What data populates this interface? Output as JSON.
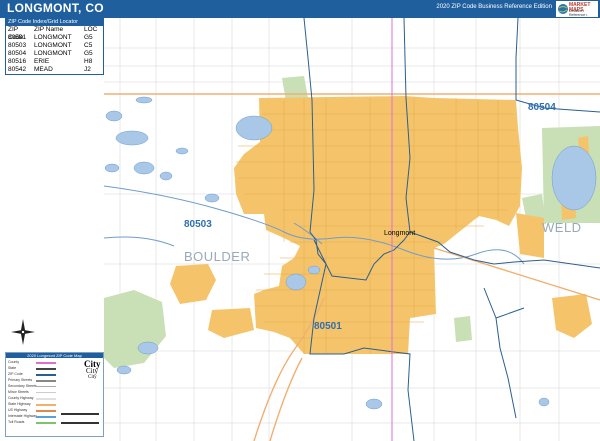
{
  "header": {
    "city": "LONGMONT, CO",
    "edition": "2020 ZIP Code Business Reference Edition"
  },
  "brand": {
    "name": "MARKET MAPS",
    "sub": "Detailed • Reference • Edition"
  },
  "zip_index": {
    "title": "ZIP Code Index/Grid Locator",
    "headers": [
      "ZIP Code",
      "ZIP Name",
      "LOC"
    ],
    "rows": [
      [
        "80501",
        "LONGMONT",
        "G5"
      ],
      [
        "80503",
        "LONGMONT",
        "C5"
      ],
      [
        "80504",
        "LONGMONT",
        "G5"
      ],
      [
        "80516",
        "ERIE",
        "H8"
      ],
      [
        "80542",
        "MEAD",
        "J2"
      ]
    ]
  },
  "map": {
    "zip_labels": [
      "80504",
      "80503",
      "80501"
    ],
    "county_labels": [
      "BOULDER",
      "WELD"
    ],
    "city_label": "Longmont",
    "colors": {
      "city_fill": "#f5c46a",
      "water": "#a9c8e8",
      "park": "#c9dfb5",
      "zip_boundary": "#2b5f8f",
      "county_boundary": "#e070d0",
      "highway": "#f0b070",
      "grid": "#d0d0d0"
    }
  },
  "legend": {
    "title": "2020 Longmont ZIP Code Map",
    "items": [
      "County",
      "State",
      "ZIP Code",
      "Primary Streets",
      "Secondary Streets",
      "Minor Streets",
      "County Highway",
      "State Highway",
      "US Highway",
      "Interstate Highway",
      "Toll Roads"
    ],
    "city_samples": [
      "City",
      "City",
      "City"
    ]
  }
}
